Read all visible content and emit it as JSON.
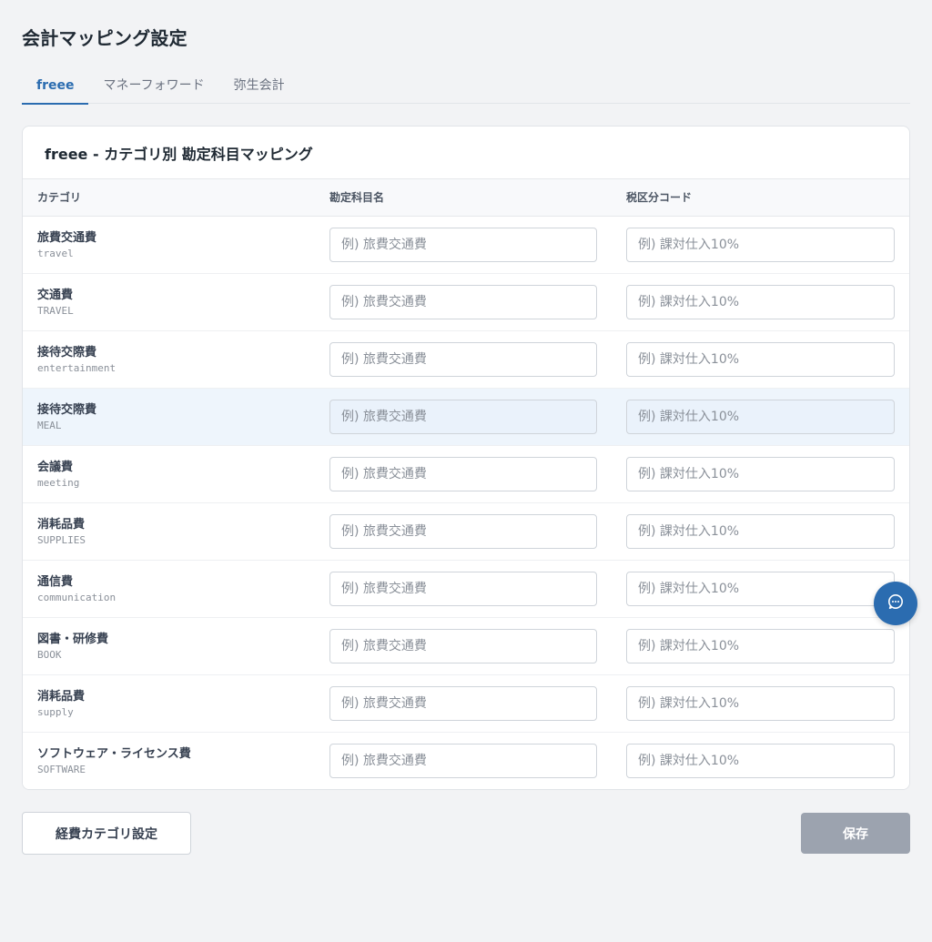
{
  "page": {
    "title": "会計マッピング設定"
  },
  "tabs": [
    {
      "label": "freee",
      "active": true
    },
    {
      "label": "マネーフォワード",
      "active": false
    },
    {
      "label": "弥生会計",
      "active": false
    }
  ],
  "card": {
    "title": "freee - カテゴリ別 勘定科目マッピング",
    "columns": [
      "カテゴリ",
      "勘定科目名",
      "税区分コード"
    ]
  },
  "placeholders": {
    "account": "例) 旅費交通費",
    "tax": "例) 課対仕入10%"
  },
  "rows": [
    {
      "name": "旅費交通費",
      "key": "travel"
    },
    {
      "name": "交通費",
      "key": "TRAVEL"
    },
    {
      "name": "接待交際費",
      "key": "entertainment"
    },
    {
      "name": "接待交際費",
      "key": "MEAL"
    },
    {
      "name": "会議費",
      "key": "meeting"
    },
    {
      "name": "消耗品費",
      "key": "SUPPLIES"
    },
    {
      "name": "通信費",
      "key": "communication"
    },
    {
      "name": "図書・研修費",
      "key": "BOOK"
    },
    {
      "name": "消耗品費",
      "key": "supply"
    },
    {
      "name": "ソフトウェア・ライセンス費",
      "key": "SOFTWARE"
    }
  ],
  "buttons": {
    "category_settings": "経費カテゴリ設定",
    "save": "保存"
  },
  "icons": {
    "fab": "chat-bubble-icon"
  },
  "colors": {
    "accent": "#2b6cb0",
    "disabled": "#9ca3af",
    "hover_row": "#eef5fc"
  }
}
